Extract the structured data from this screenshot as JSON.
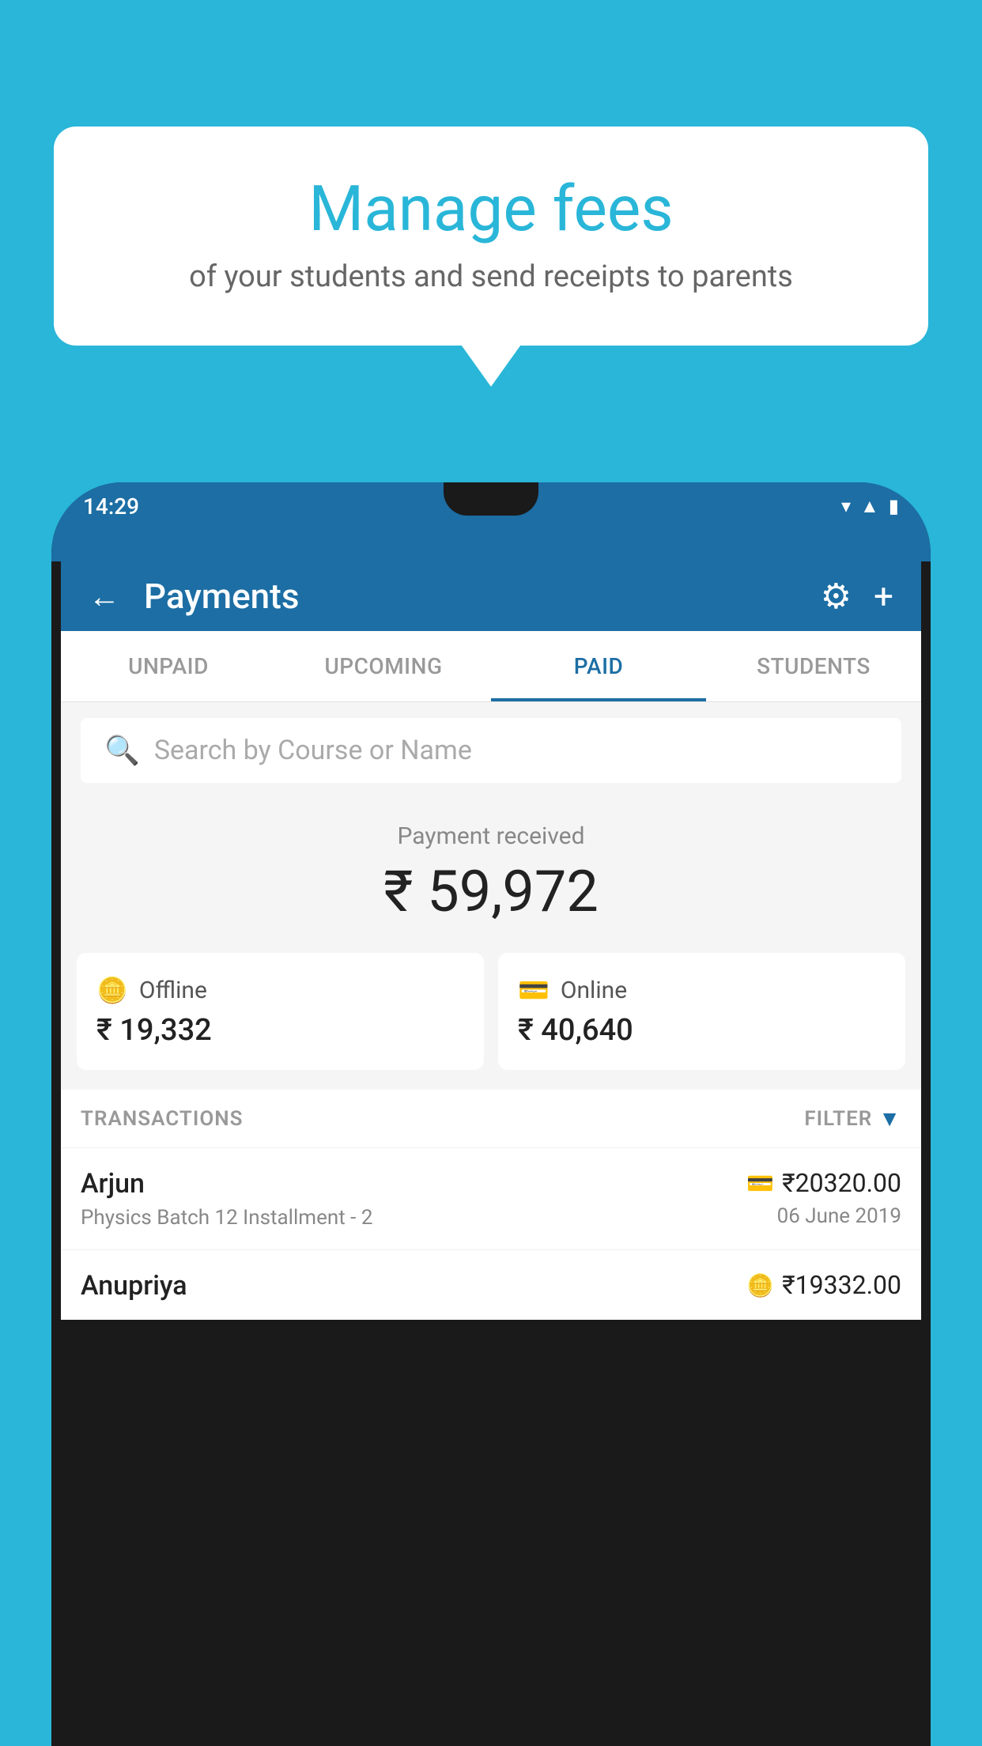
{
  "background_color": "#29b6d8",
  "bubble": {
    "title": "Manage fees",
    "subtitle": "of your students and send receipts to parents"
  },
  "phone": {
    "status_bar": {
      "time": "14:29",
      "icons": [
        "wifi",
        "signal",
        "battery"
      ]
    },
    "header": {
      "title": "Payments",
      "back_label": "←",
      "settings_icon": "⚙",
      "add_icon": "+"
    },
    "tabs": [
      {
        "label": "UNPAID",
        "active": false
      },
      {
        "label": "UPCOMING",
        "active": false
      },
      {
        "label": "PAID",
        "active": true
      },
      {
        "label": "STUDENTS",
        "active": false
      }
    ],
    "search": {
      "placeholder": "Search by Course or Name"
    },
    "payment_summary": {
      "label": "Payment received",
      "amount": "₹ 59,972",
      "cards": [
        {
          "label": "Offline",
          "icon": "offline",
          "amount": "₹ 19,332"
        },
        {
          "label": "Online",
          "icon": "online",
          "amount": "₹ 40,640"
        }
      ]
    },
    "transactions": {
      "header_label": "TRANSACTIONS",
      "filter_label": "FILTER",
      "rows": [
        {
          "name": "Arjun",
          "detail": "Physics Batch 12 Installment - 2",
          "amount": "₹20320.00",
          "date": "06 June 2019",
          "icon": "card"
        },
        {
          "name": "Anupriya",
          "detail": "",
          "amount": "₹19332.00",
          "date": "",
          "icon": "cash"
        }
      ]
    }
  }
}
